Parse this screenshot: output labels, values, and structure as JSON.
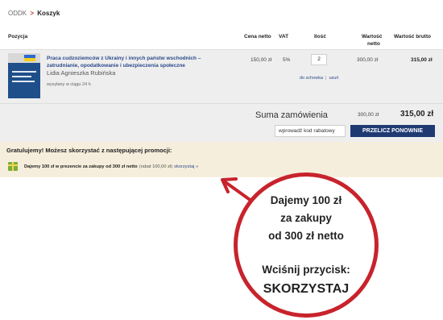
{
  "breadcrumb": {
    "root": "ODDK",
    "separator": ">",
    "current": "Koszyk"
  },
  "table": {
    "headers": {
      "position": "Pozycja",
      "net_price": "Cena netto",
      "vat": "VAT",
      "quantity": "Ilość",
      "net_value_1": "Wartość",
      "net_value_2": "netto",
      "gross_value": "Wartość brutto"
    },
    "item": {
      "title_line1": "Praca cudzoziemców z Ukrainy i innych państw wschodnich –",
      "title_line2": "zatrudnianie, opodatkowanie i ubezpieczenia społeczne",
      "author": "Lidia Agnieszka Rubińska",
      "shipping": "wysyłany w ciągu 24 h",
      "net_price": "150,00 zł",
      "vat": "5%",
      "quantity": "2",
      "net_value": "300,00 zł",
      "gross_value": "315,00 zł",
      "action_clipboard": "do schowka",
      "action_separator": "|",
      "action_remove": "usuń"
    }
  },
  "summary": {
    "label": "Suma zamówienia",
    "net_total": "300,00 zł",
    "gross_total": "315,00 zł",
    "discount_placeholder": "wprowadź kod rabatowy",
    "recalculate_label": "PRZELICZ PONOWNIE"
  },
  "promotion": {
    "heading": "Gratulujemy! Możesz skorzystać z następującej promocji:",
    "offer": "Dajemy 100 zł w prezencie za zakupy od 300 zł netto",
    "rebate": "(rabat 100,00 zł)",
    "link": "skorzystaj »"
  },
  "callout": {
    "line1": "Dajemy 100 zł",
    "line2": "za zakupy",
    "line3": "od 300 zł netto",
    "line4": "Wciśnij przycisk:",
    "line5": "SKORZYSTAJ"
  },
  "colors": {
    "accent_red": "#c8232c",
    "link_blue": "#2b4a8b",
    "button_navy": "#1f3a73",
    "promo_background": "#f6eedc",
    "gift_green": "#7cae3a"
  },
  "icons": {
    "promo": "gift-icon",
    "pointer": "arrow-icon"
  }
}
